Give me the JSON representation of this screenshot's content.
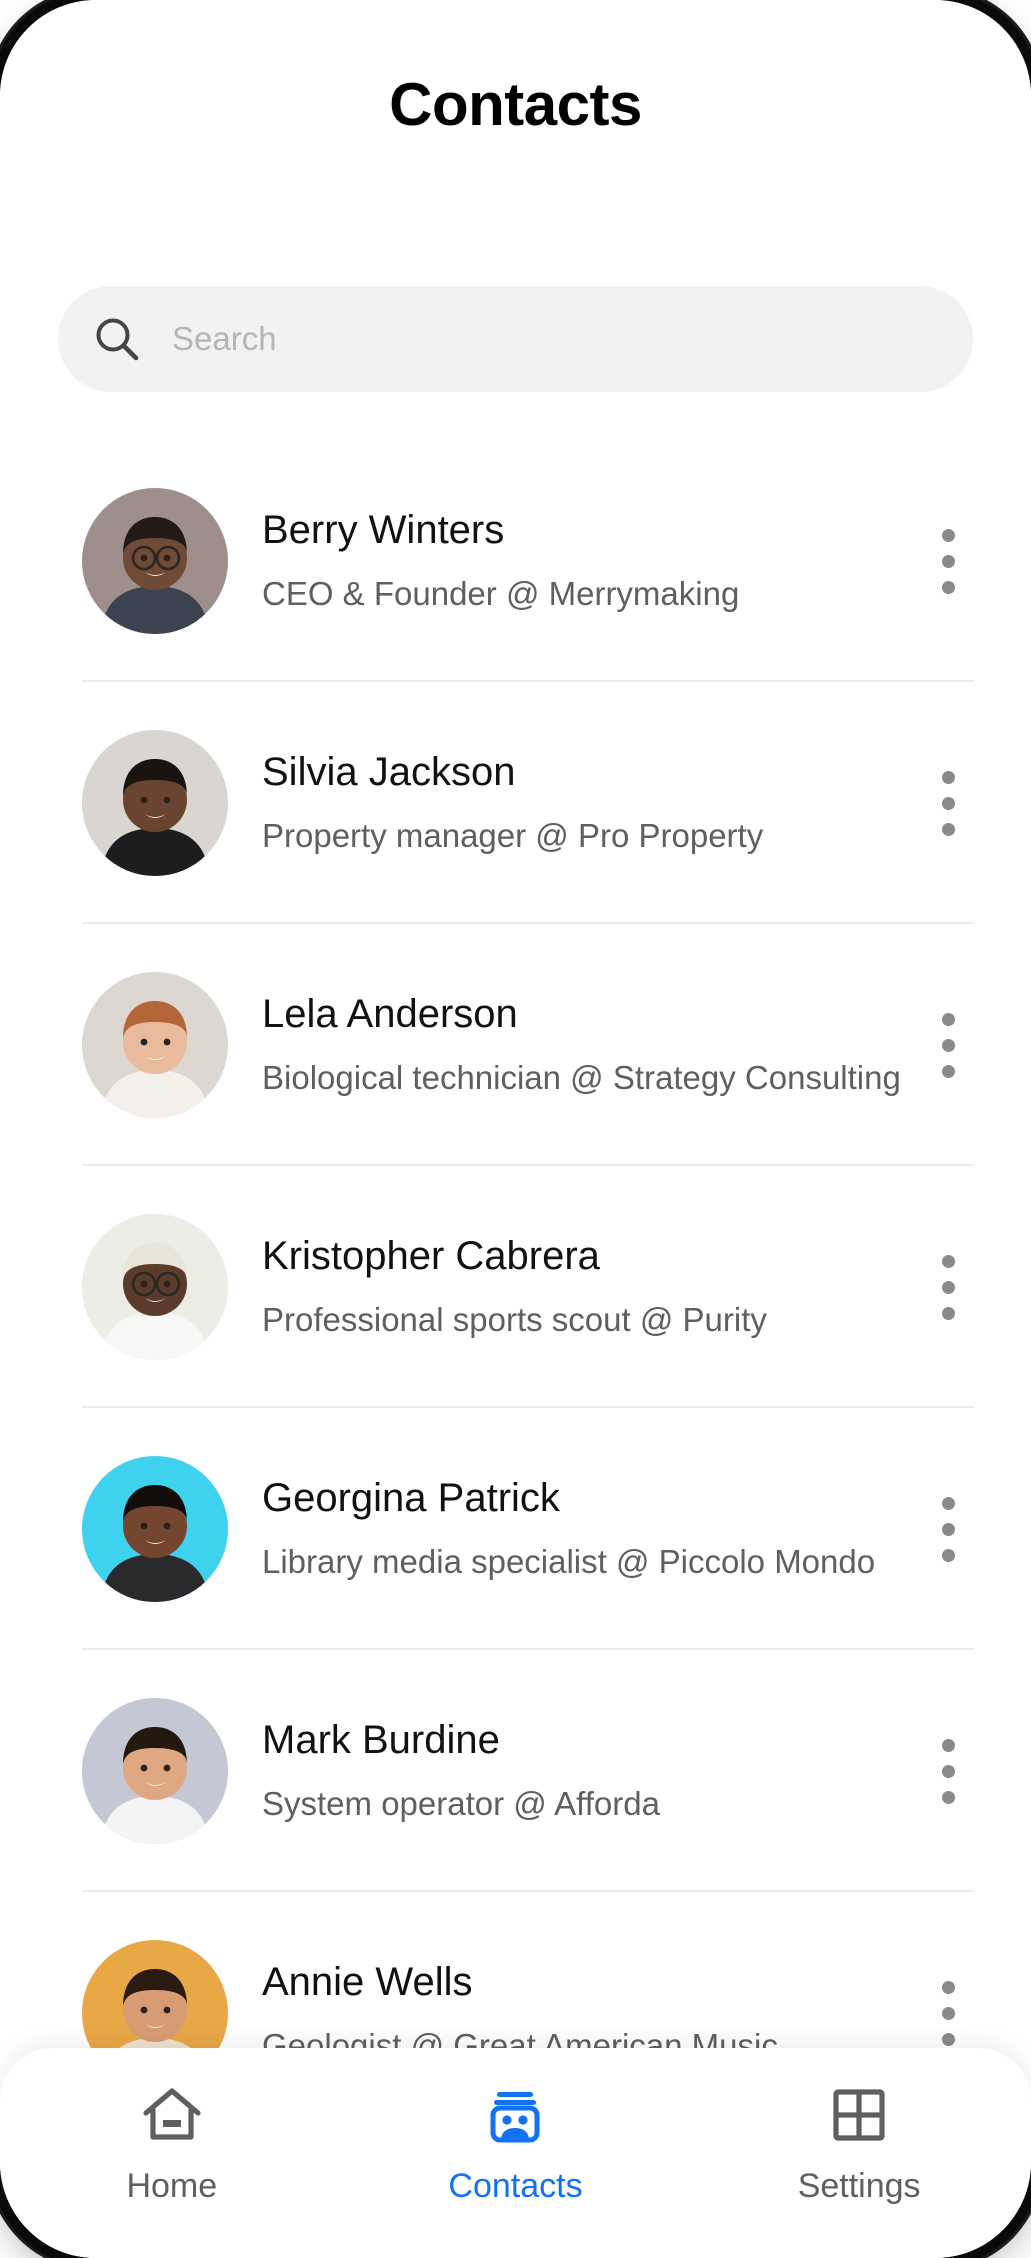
{
  "header": {
    "title": "Contacts"
  },
  "search": {
    "placeholder": "Search",
    "value": "",
    "icon": "search-icon"
  },
  "contacts": [
    {
      "name": "Berry Winters",
      "role": "CEO & Founder @ Merrymaking",
      "avatar_bg": "#9e8e8c",
      "skin": "#6f4a35",
      "hair": "#221a16",
      "shirt": "#3b4250",
      "glasses": true,
      "menu_icon": "more-vertical-icon"
    },
    {
      "name": "Silvia Jackson",
      "role": "Property manager @ Pro Property",
      "avatar_bg": "#d9d6d2",
      "skin": "#6b4430",
      "hair": "#1a1410",
      "shirt": "#1d1d1f",
      "glasses": false,
      "menu_icon": "more-vertical-icon"
    },
    {
      "name": "Lela Anderson",
      "role": "Biological technician @ Strategy Consulting",
      "avatar_bg": "#dcd8d1",
      "skin": "#e7bb9c",
      "hair": "#b4653a",
      "shirt": "#f3f0ec",
      "glasses": false,
      "menu_icon": "more-vertical-icon"
    },
    {
      "name": "Kristopher Cabrera",
      "role": "Professional sports scout @ Purity",
      "avatar_bg": "#eceee6",
      "skin": "#5c3b2a",
      "hair": "#e8e4da",
      "shirt": "#f7f7f5",
      "glasses": true,
      "menu_icon": "more-vertical-icon"
    },
    {
      "name": "Georgina Patrick",
      "role": "Library media specialist @ Piccolo Mondo",
      "avatar_bg": "#3ed2ee",
      "skin": "#74452f",
      "hair": "#120d0b",
      "shirt": "#2a2a2c",
      "glasses": false,
      "menu_icon": "more-vertical-icon"
    },
    {
      "name": "Mark Burdine",
      "role": "System operator @ Afforda",
      "avatar_bg": "#c3c8d4",
      "skin": "#dfa882",
      "hair": "#23190f",
      "shirt": "#f4f4f4",
      "glasses": false,
      "menu_icon": "more-vertical-icon"
    },
    {
      "name": "Annie Wells",
      "role": "Geologist @ Great American Music",
      "avatar_bg": "#e9a846",
      "skin": "#d79c74",
      "hair": "#2a1a12",
      "shirt": "#f0e2d0",
      "glasses": false,
      "menu_icon": "more-vertical-icon"
    }
  ],
  "bottom_nav": {
    "active_color": "#1272f5",
    "inactive_color": "#5f5f5f",
    "items": [
      {
        "label": "Home",
        "icon": "home-icon",
        "active": false
      },
      {
        "label": "Contacts",
        "icon": "contacts-icon",
        "active": true
      },
      {
        "label": "Settings",
        "icon": "grid-icon",
        "active": false
      }
    ]
  }
}
